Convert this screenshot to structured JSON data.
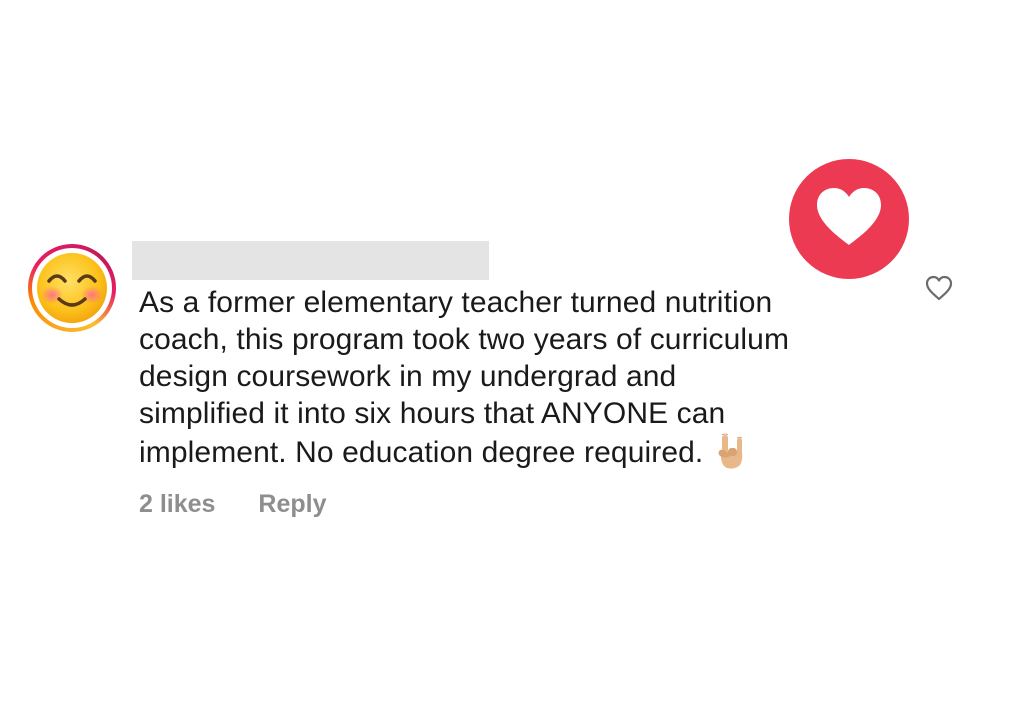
{
  "comment": {
    "avatar_icon": "smiling-face-with-smiling-eyes-icon",
    "author_redacted": true,
    "text_lines": [
      "As a former elementary teacher turned nutrition",
      "coach, this program took two years of curriculum",
      "design coursework in my undergrad and",
      "simplified it into six hours that ANYONE can",
      "implement. No education degree required."
    ],
    "trailing_emoji": "sign-of-the-horns-hand-icon",
    "likes_label": "2 likes",
    "reply_label": "Reply",
    "like_icon": "heart-outline-icon"
  },
  "reaction": {
    "icon": "heart-reaction-icon",
    "color": "#ec3a53"
  },
  "colors": {
    "text": "#1a1a1a",
    "meta": "#8e8e8e",
    "redaction": "#e4e4e4"
  }
}
